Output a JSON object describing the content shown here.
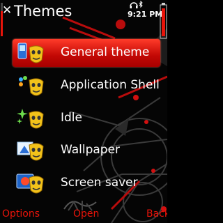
{
  "header": {
    "title": "Themes",
    "clock": "9:21 PM"
  },
  "menu": {
    "items": [
      {
        "label": "General theme",
        "icon": "general-theme-icon",
        "selected": true
      },
      {
        "label": "Application Shell",
        "icon": "application-shell-icon",
        "selected": false
      },
      {
        "label": "Idle",
        "icon": "idle-icon",
        "selected": false
      },
      {
        "label": "Wallpaper",
        "icon": "wallpaper-icon",
        "selected": false
      },
      {
        "label": "Screen saver",
        "icon": "screen-saver-icon",
        "selected": false
      }
    ]
  },
  "softkeys": {
    "left": "Options",
    "middle": "Open",
    "right": "Back"
  },
  "colors": {
    "accent": "#e8140a",
    "highlight": "#c20804",
    "background": "#050505",
    "mask_yellow": "#f2c21a"
  }
}
